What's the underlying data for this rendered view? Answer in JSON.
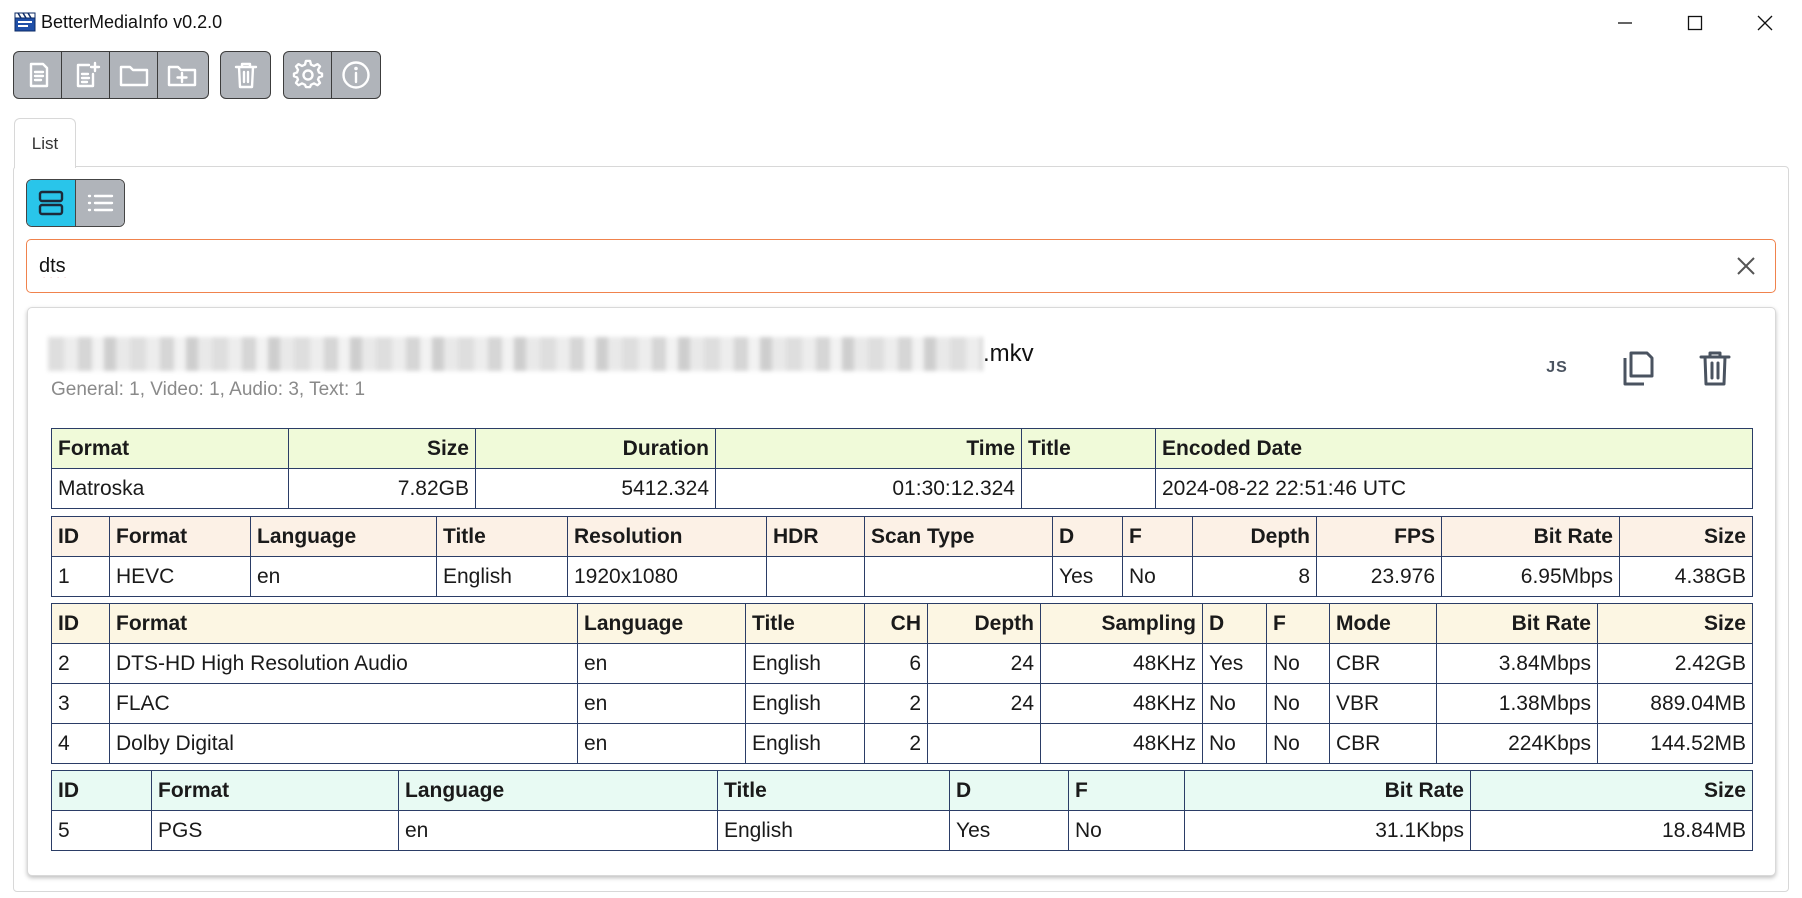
{
  "window": {
    "title": "BetterMediaInfo v0.2.0"
  },
  "toolbar": {
    "buttons": [
      {
        "name": "open-file-icon"
      },
      {
        "name": "add-file-icon"
      },
      {
        "name": "open-folder-icon"
      },
      {
        "name": "add-folder-icon"
      },
      {
        "name": "clear-list-icon"
      },
      {
        "name": "settings-icon"
      },
      {
        "name": "about-icon"
      }
    ]
  },
  "tabs": [
    {
      "label": "List"
    }
  ],
  "view_toggle": {
    "active": "card-view",
    "options": [
      "card-view",
      "list-view"
    ]
  },
  "search": {
    "value": "dts",
    "placeholder": ""
  },
  "colors": {
    "accent": "#29c5ea",
    "search_border": "#f0834d",
    "table_border": "#2b3d66"
  },
  "file": {
    "name_ext": ".mkv",
    "summary": "General: 1, Video: 1, Audio: 3, Text: 1",
    "actions": {
      "json_label": "JS"
    },
    "general": {
      "headers": [
        "Format",
        "Size",
        "Duration",
        "Time",
        "Title",
        "Encoded Date"
      ],
      "rows": [
        [
          "Matroska",
          "7.82GB",
          "5412.324",
          "01:30:12.324",
          "",
          "2024-08-22 22:51:46 UTC"
        ]
      ]
    },
    "video": {
      "headers": [
        "ID",
        "Format",
        "Language",
        "Title",
        "Resolution",
        "HDR",
        "Scan Type",
        "D",
        "F",
        "Depth",
        "FPS",
        "Bit Rate",
        "Size"
      ],
      "rows": [
        [
          "1",
          "HEVC",
          "en",
          "English",
          "1920x1080",
          "",
          "",
          "Yes",
          "No",
          "8",
          "23.976",
          "6.95Mbps",
          "4.38GB"
        ]
      ]
    },
    "audio": {
      "headers": [
        "ID",
        "Format",
        "Language",
        "Title",
        "CH",
        "Depth",
        "Sampling",
        "D",
        "F",
        "Mode",
        "Bit Rate",
        "Size"
      ],
      "rows": [
        [
          "2",
          "DTS-HD High Resolution Audio",
          "en",
          "English",
          "6",
          "24",
          "48KHz",
          "Yes",
          "No",
          "CBR",
          "3.84Mbps",
          "2.42GB"
        ],
        [
          "3",
          "FLAC",
          "en",
          "English",
          "2",
          "24",
          "48KHz",
          "No",
          "No",
          "VBR",
          "1.38Mbps",
          "889.04MB"
        ],
        [
          "4",
          "Dolby Digital",
          "en",
          "English",
          "2",
          "",
          "48KHz",
          "No",
          "No",
          "CBR",
          "224Kbps",
          "144.52MB"
        ]
      ]
    },
    "text": {
      "headers": [
        "ID",
        "Format",
        "Language",
        "Title",
        "D",
        "F",
        "Bit Rate",
        "Size"
      ],
      "rows": [
        [
          "5",
          "PGS",
          "en",
          "English",
          "Yes",
          "No",
          "31.1Kbps",
          "18.84MB"
        ]
      ]
    }
  }
}
